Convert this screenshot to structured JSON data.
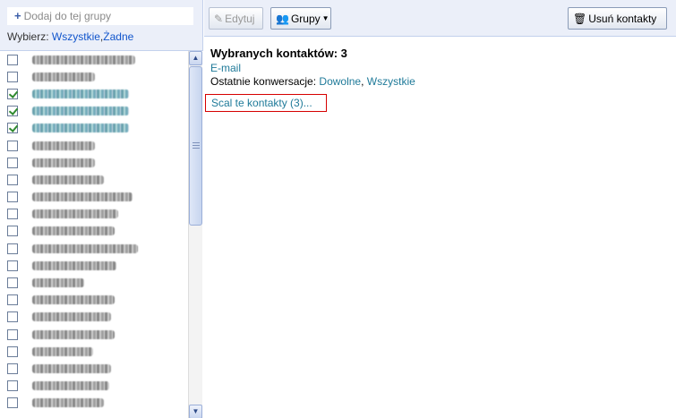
{
  "left_panel": {
    "add_group": {
      "plus": "+",
      "label": "Dodaj do tej grupy"
    },
    "select": {
      "label": "Wybierz:",
      "all": "Wszystkie",
      "sep": ",",
      "none": "Żadne"
    },
    "contacts": [
      {
        "checked": false,
        "w": 115
      },
      {
        "checked": false,
        "w": 70
      },
      {
        "checked": true,
        "w": 108
      },
      {
        "checked": true,
        "w": 108
      },
      {
        "checked": true,
        "w": 108
      },
      {
        "checked": false,
        "w": 70
      },
      {
        "checked": false,
        "w": 70
      },
      {
        "checked": false,
        "w": 80
      },
      {
        "checked": false,
        "w": 112
      },
      {
        "checked": false,
        "w": 96
      },
      {
        "checked": false,
        "w": 92
      },
      {
        "checked": false,
        "w": 118
      },
      {
        "checked": false,
        "w": 94
      },
      {
        "checked": false,
        "w": 58
      },
      {
        "checked": false,
        "w": 92
      },
      {
        "checked": false,
        "w": 88
      },
      {
        "checked": false,
        "w": 92
      },
      {
        "checked": false,
        "w": 68
      },
      {
        "checked": false,
        "w": 88
      },
      {
        "checked": false,
        "w": 86
      },
      {
        "checked": false,
        "w": 80
      }
    ]
  },
  "toolbar": {
    "edit_label": "Edytuj",
    "groups_label": "Grupy",
    "delete_label": "Usuń kontakty"
  },
  "content": {
    "selected_title": "Wybranych kontaktów: 3",
    "email_link": "E-mail",
    "conversations_label": "Ostatnie konwersacje:",
    "conv_any": "Dowolne",
    "conv_sep": ",",
    "conv_all": "Wszystkie",
    "merge_label": "Scal te kontakty (3)..."
  },
  "colors": {
    "accent_link": "#1f7a99",
    "panel_bg": "#ebeff9",
    "merge_border": "#d60000"
  }
}
